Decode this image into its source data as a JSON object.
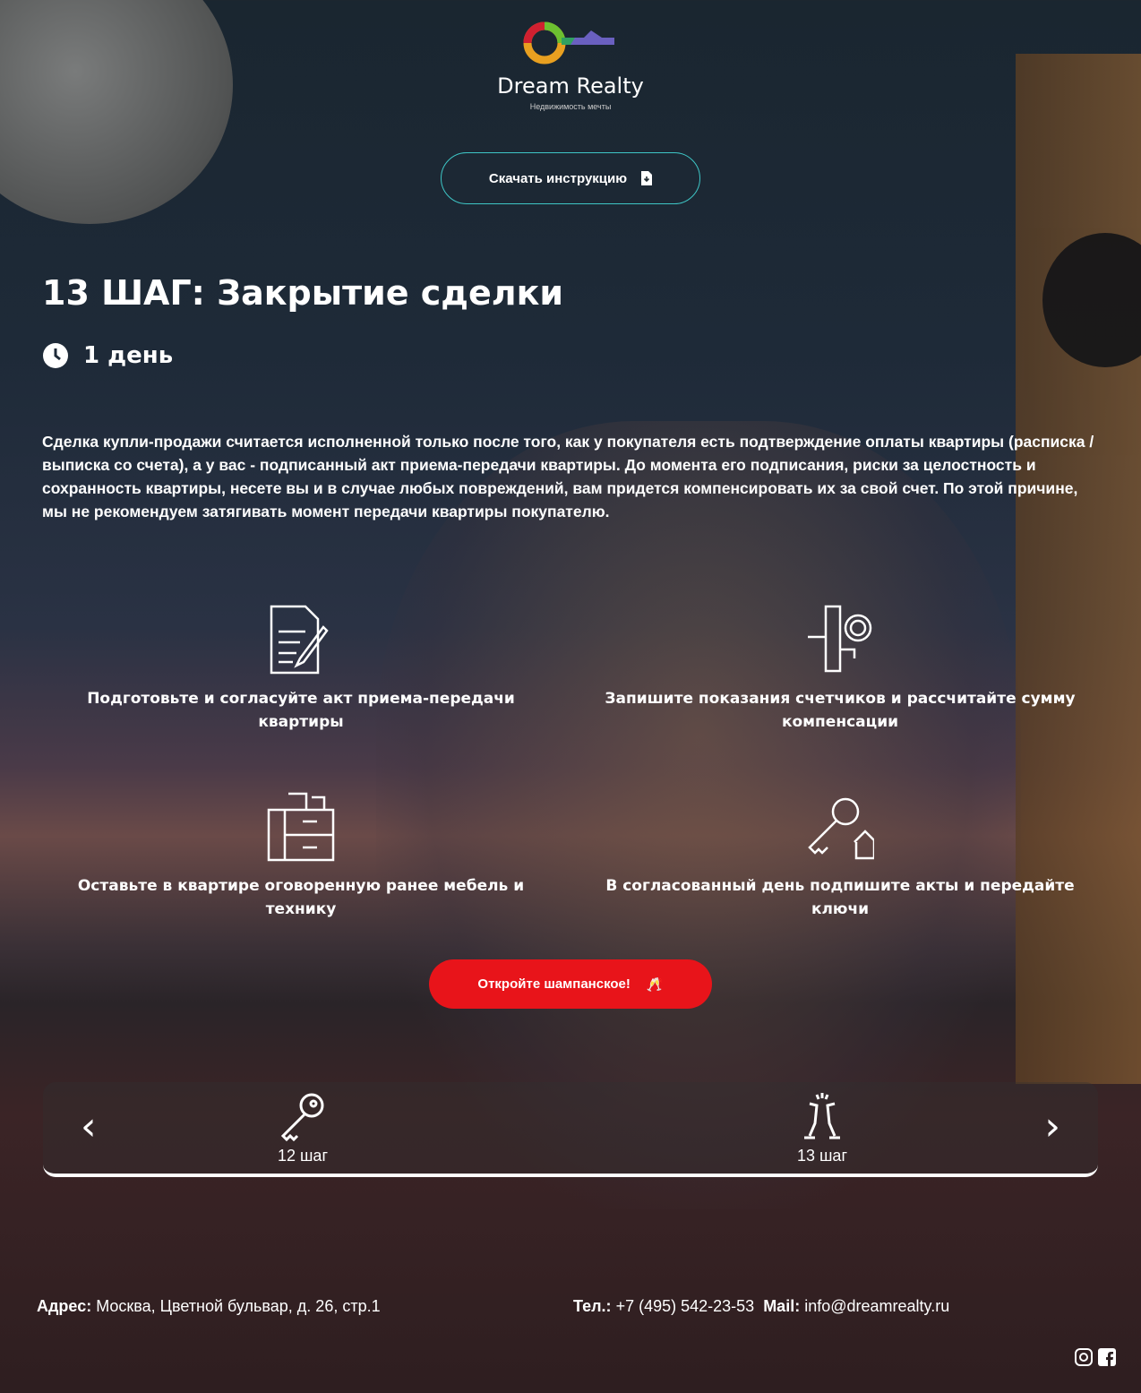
{
  "brand": {
    "name": "Dream Realty",
    "tagline": "Недвижимость мечты"
  },
  "download_label": "Скачать инструкцию",
  "title": "13 ШАГ: Закрытие сделки",
  "duration": "1 день",
  "description": "Сделка купли-продажи считается исполненной только после того, как у покупателя есть подтверждение оплаты квартиры (расписка / выписка со счета), а у вас - подписанный акт приема-передачи квартиры. До момента его подписания, риски за целостность и сохранность квартиры, несете вы и в случае любых повреждений, вам придется компенсировать их за свой счет. По этой причине, мы не рекомендуем затягивать момент передачи квартиры покупателю.",
  "steps": [
    {
      "label": "Подготовьте и согласуйте акт приема-передачи квартиры",
      "icon": "document-pen-icon"
    },
    {
      "label": "Запишите показания счетчиков и рассчитайте сумму компенсации",
      "icon": "meter-icon"
    },
    {
      "label": "Оставьте в квартире оговоренную ранее мебель и технику",
      "icon": "furniture-icon"
    },
    {
      "label": "В согласованный день подпишите акты и передайте ключи",
      "icon": "key-house-icon"
    }
  ],
  "cta_label": "Откройте шампанское!",
  "slider": {
    "items": [
      {
        "label": "12 шаг",
        "icon": "key-icon"
      },
      {
        "label": "13 шаг",
        "icon": "champagne-icon"
      }
    ]
  },
  "footer": {
    "address_label": "Адрес:",
    "address": "Москва, Цветной бульвар, д. 26, стр.1",
    "phone_label": "Тел.:",
    "phone": "+7 (495) 542-23-53",
    "mail_label": "Mail:",
    "mail": "info@dreamrealty.ru"
  },
  "colors": {
    "accent": "#3ec6c6",
    "cta": "#e8141a"
  }
}
